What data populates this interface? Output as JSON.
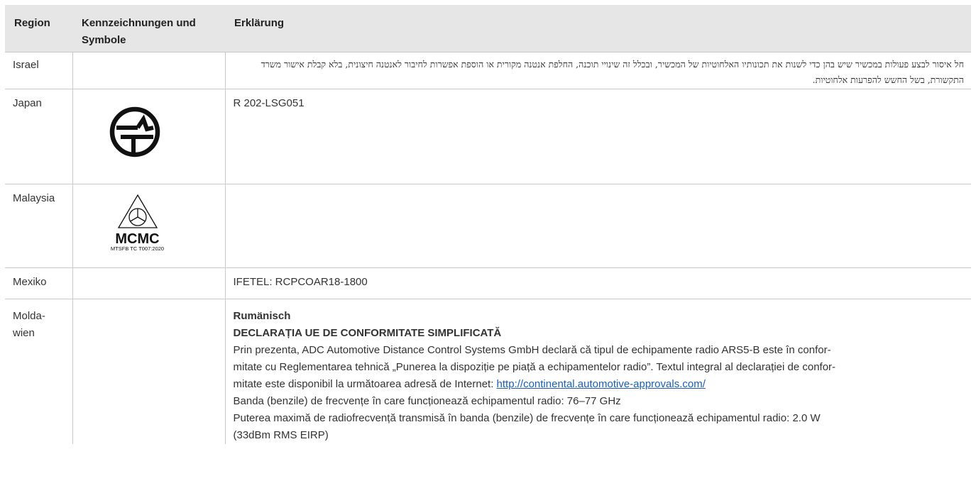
{
  "table": {
    "headers": [
      "Region",
      "Kennzeichnungen und Symbole",
      "Erklärung"
    ],
    "rows": {
      "israel": {
        "region": "Israel",
        "text": "חל איסור לבצע פעולות במכשיר שיש בהן כדי לשנות את תכונותיו האלחוטיות של המכשיר, ובכלל זה שינויי תוכנה, החלפת אנטנה מקורית או הוספת אפשרות לחיבור לאנטנה חיצונית, בלא קבלת אישור משרד התקשורת, בשל החשש להפרעות אלחוטיות."
      },
      "japan": {
        "region": "Japan",
        "symbol_icon": "giteki-telec-mark-icon",
        "text": "R 202-LSG051"
      },
      "malaysia": {
        "region": "Malaysia",
        "symbol_icon": "mcmc-logo-icon",
        "logo_word": "MCMC",
        "logo_sub": "MTSFB TC T007:2020",
        "text": ""
      },
      "mexiko": {
        "region": "Mexiko",
        "text": "IFETEL: RCPCOAR18-1800"
      },
      "moldawien": {
        "region_line1": "Molda-",
        "region_line2": "wien",
        "language": "Rumänisch",
        "decl_title": "DECLARAȚIA UE DE CONFORMITATE SIMPLIFICATĂ",
        "para1_line1": "Prin prezenta, ADC Automotive Distance Control Systems GmbH declară că tipul de echipamente radio ARS5-B este în confor-",
        "para1_line2": "mitate cu Reglementarea tehnică „Punerea la dispoziție pe piață a echipamentelor radio”. Textul integral al declarației de confor-",
        "para1_line3": "mitate este disponibil la următoarea adresă de Internet: ",
        "link": "http://continental.automotive-approvals.com/",
        "band": "Banda (benzile) de frecvențe în care funcționează echipamentul radio: 76–77 GHz",
        "power_line1": "Puterea maximă de radiofrecvență transmisă în banda (benzile) de frecvențe în care funcționează echipamentul radio: 2.0 W",
        "power_line2": "(33dBm RMS EIRP)"
      }
    }
  }
}
